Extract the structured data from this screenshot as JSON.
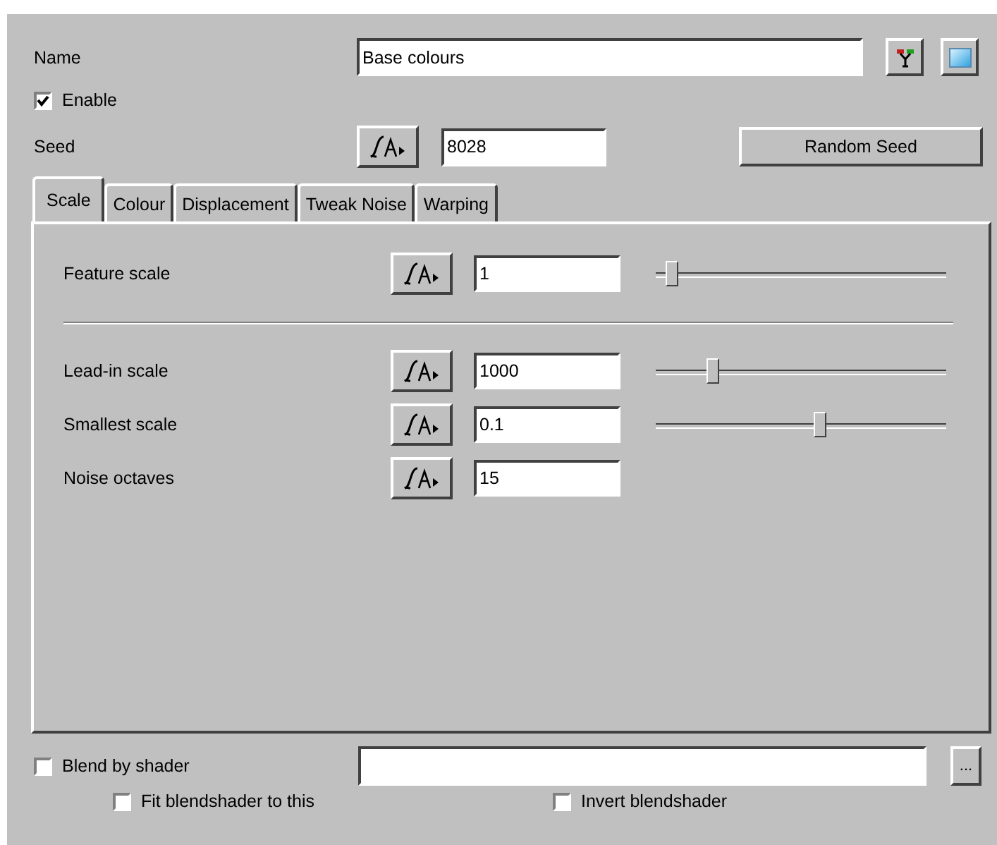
{
  "name": {
    "label": "Name",
    "value": "Base colours"
  },
  "enable": {
    "label": "Enable",
    "checked": true
  },
  "seed": {
    "label": "Seed",
    "value": "8028",
    "button": "Random Seed"
  },
  "tabs": [
    {
      "label": "Scale",
      "selected": true
    },
    {
      "label": "Colour",
      "selected": false
    },
    {
      "label": "Displacement",
      "selected": false
    },
    {
      "label": "Tweak Noise",
      "selected": false
    },
    {
      "label": "Warping",
      "selected": false
    }
  ],
  "params": [
    {
      "label": "Feature scale",
      "value": "1",
      "kind": "slider",
      "level": 0.06,
      "divider_after": true
    },
    {
      "label": "Lead-in scale",
      "value": "1000",
      "kind": "slider",
      "level": 0.2,
      "divider_after": false
    },
    {
      "label": "Smallest scale",
      "value": "0.1",
      "kind": "slider",
      "level": 0.57,
      "divider_after": false
    },
    {
      "label": "Noise octaves",
      "value": "15",
      "kind": "plain",
      "divider_after": false
    }
  ],
  "blend": {
    "label": "Blend by shader",
    "checked": false,
    "browse": "..."
  },
  "options": [
    {
      "label": "Fit blendshader to this",
      "checked": false
    },
    {
      "label": "Invert blendshader",
      "checked": false
    }
  ]
}
